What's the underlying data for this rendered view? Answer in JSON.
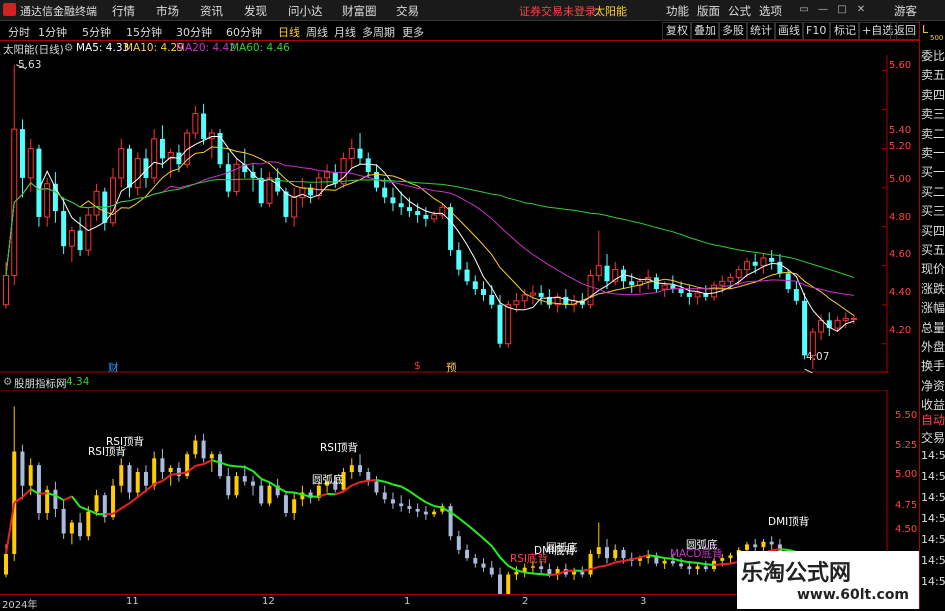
{
  "menubar": {
    "app_title": "通达信金融终端",
    "items": [
      "行情",
      "市场",
      "资讯",
      "发现",
      "问小达",
      "财富圈",
      "交易"
    ],
    "login_status": "证券交易未登录",
    "stock_name": "太阳能",
    "right_items": [
      "功能",
      "版面",
      "公式",
      "选项"
    ],
    "user": "游客"
  },
  "toolbar": {
    "periods": [
      "分时",
      "1分钟",
      "5分钟",
      "15分钟",
      "30分钟",
      "60分钟",
      "日线",
      "周线",
      "月线",
      "多周期",
      "更多"
    ],
    "active_period": "日线",
    "right_buttons": [
      "复权",
      "叠加",
      "多股",
      "统计",
      "画线",
      "F10",
      "标记",
      "+自选",
      "返回"
    ]
  },
  "main_chart": {
    "title": "太阳能(日线)",
    "ma": [
      {
        "label": "MA5: 4.33",
        "color": "#ffffff"
      },
      {
        "label": "MA10: 4.29",
        "color": "#ffcc33"
      },
      {
        "label": "MA20: 4.42",
        "color": "#cc33cc"
      },
      {
        "label": "MA60: 4.46",
        "color": "#33cc33"
      }
    ],
    "high_label": "5.63",
    "low_label": "4.07",
    "markers": [
      {
        "text": "财",
        "color": "#3399ff"
      },
      {
        "text": "$",
        "color": "#ff3333"
      },
      {
        "text": "预",
        "color": "#ffcc33"
      }
    ],
    "y_ticks": [
      "5.60",
      "5.40",
      "5.20",
      "5.00",
      "4.80",
      "4.60",
      "4.40",
      "4.20"
    ]
  },
  "indicator": {
    "title": "股朋指标网",
    "value": "4.34",
    "y_ticks": [
      "5.50",
      "5.25",
      "5.00",
      "4.75",
      "4.50"
    ],
    "annotations": [
      {
        "text": "RSI顶背",
        "color": "#ffffff"
      },
      {
        "text": "RSI顶背",
        "color": "#ffffff"
      },
      {
        "text": "RSI顶背",
        "color": "#ffffff"
      },
      {
        "text": "圆弧底",
        "color": "#ffffff"
      },
      {
        "text": "DMI底背",
        "color": "#ffffff"
      },
      {
        "text": "圆弧底",
        "color": "#ffffff"
      },
      {
        "text": "RSI底背",
        "color": "#ff4444"
      },
      {
        "text": "圆弧底",
        "color": "#ffffff"
      },
      {
        "text": "MACD底背",
        "color": "#cc33cc"
      },
      {
        "text": "DMI顶背",
        "color": "#ffffff"
      }
    ]
  },
  "dates": [
    "2024年",
    "11",
    "12",
    "1",
    "2",
    "3"
  ],
  "right_panel": {
    "header_l": "L",
    "header_num": "500",
    "items": [
      "委比",
      "卖五",
      "卖四",
      "卖三",
      "卖二",
      "卖一",
      "买一",
      "买二",
      "买三",
      "买四",
      "买五",
      "现价",
      "涨跌",
      "涨幅",
      "总量",
      "外盘",
      "换手",
      "净资",
      "收益"
    ],
    "auto_label": "自动",
    "trade_label": "交易",
    "times": [
      "14:56",
      "14:56",
      "14:56",
      "14:56",
      "14:56",
      "14:56",
      "14:56"
    ]
  },
  "watermark": {
    "title": "乐淘公式网",
    "url": "www.60lt.com"
  },
  "chart_data": {
    "type": "candlestick",
    "price_axis": {
      "min": 4.07,
      "max": 5.63,
      "ticks": [
        5.6,
        5.4,
        5.2,
        5.0,
        4.8,
        4.6,
        4.4,
        4.2
      ]
    },
    "candles": [
      [
        4.4,
        4.62,
        4.38,
        4.55
      ],
      [
        4.55,
        5.63,
        4.5,
        5.3
      ],
      [
        5.3,
        5.35,
        4.95,
        5.05
      ],
      [
        5.05,
        5.25,
        4.98,
        5.2
      ],
      [
        5.2,
        5.22,
        4.8,
        4.85
      ],
      [
        4.85,
        5.05,
        4.8,
        5.02
      ],
      [
        5.02,
        5.08,
        4.82,
        4.88
      ],
      [
        4.88,
        4.95,
        4.66,
        4.7
      ],
      [
        4.7,
        4.8,
        4.62,
        4.78
      ],
      [
        4.78,
        4.85,
        4.65,
        4.68
      ],
      [
        4.68,
        4.9,
        4.65,
        4.86
      ],
      [
        4.86,
        5.02,
        4.83,
        4.98
      ],
      [
        4.98,
        5.0,
        4.78,
        4.82
      ],
      [
        4.82,
        5.1,
        4.8,
        5.05
      ],
      [
        5.05,
        5.25,
        5.0,
        5.2
      ],
      [
        5.2,
        5.22,
        4.95,
        5.0
      ],
      [
        5.0,
        5.18,
        4.96,
        5.15
      ],
      [
        5.15,
        5.2,
        5.0,
        5.05
      ],
      [
        5.05,
        5.3,
        5.02,
        5.25
      ],
      [
        5.25,
        5.32,
        5.1,
        5.15
      ],
      [
        5.15,
        5.2,
        5.05,
        5.18
      ],
      [
        5.18,
        5.22,
        5.08,
        5.12
      ],
      [
        5.12,
        5.3,
        5.1,
        5.28
      ],
      [
        5.28,
        5.42,
        5.25,
        5.38
      ],
      [
        5.38,
        5.43,
        5.22,
        5.25
      ],
      [
        5.25,
        5.3,
        5.15,
        5.28
      ],
      [
        5.28,
        5.3,
        5.1,
        5.12
      ],
      [
        5.12,
        5.18,
        4.95,
        4.98
      ],
      [
        4.98,
        5.15,
        4.96,
        5.12
      ],
      [
        5.12,
        5.2,
        5.05,
        5.08
      ],
      [
        5.08,
        5.12,
        4.98,
        5.05
      ],
      [
        5.05,
        5.1,
        4.9,
        4.92
      ],
      [
        4.92,
        5.08,
        4.9,
        5.05
      ],
      [
        5.05,
        5.1,
        4.96,
        4.98
      ],
      [
        4.98,
        5.0,
        4.82,
        4.85
      ],
      [
        4.85,
        5.0,
        4.8,
        4.95
      ],
      [
        4.95,
        5.05,
        4.9,
        5.0
      ],
      [
        5.0,
        5.02,
        4.92,
        4.96
      ],
      [
        4.96,
        5.08,
        4.94,
        5.05
      ],
      [
        5.05,
        5.12,
        5.0,
        5.08
      ],
      [
        5.08,
        5.12,
        5.0,
        5.02
      ],
      [
        5.02,
        5.18,
        5.0,
        5.15
      ],
      [
        5.15,
        5.25,
        5.1,
        5.2
      ],
      [
        5.2,
        5.28,
        5.12,
        5.15
      ],
      [
        5.15,
        5.18,
        5.05,
        5.08
      ],
      [
        5.08,
        5.12,
        4.98,
        5.0
      ],
      [
        5.0,
        5.05,
        4.92,
        4.95
      ],
      [
        4.95,
        5.0,
        4.88,
        4.92
      ],
      [
        4.92,
        4.98,
        4.86,
        4.9
      ],
      [
        4.9,
        4.95,
        4.85,
        4.88
      ],
      [
        4.88,
        4.92,
        4.82,
        4.86
      ],
      [
        4.86,
        4.9,
        4.8,
        4.84
      ],
      [
        4.84,
        4.88,
        4.82,
        4.86
      ],
      [
        4.86,
        4.92,
        4.84,
        4.9
      ],
      [
        4.9,
        4.92,
        4.65,
        4.68
      ],
      [
        4.68,
        4.72,
        4.55,
        4.58
      ],
      [
        4.58,
        4.62,
        4.5,
        4.52
      ],
      [
        4.52,
        4.55,
        4.45,
        4.48
      ],
      [
        4.48,
        4.52,
        4.42,
        4.45
      ],
      [
        4.45,
        4.5,
        4.38,
        4.4
      ],
      [
        4.4,
        4.45,
        4.18,
        4.2
      ],
      [
        4.2,
        4.42,
        4.18,
        4.4
      ],
      [
        4.4,
        4.46,
        4.36,
        4.42
      ],
      [
        4.42,
        4.48,
        4.38,
        4.45
      ],
      [
        4.45,
        4.5,
        4.4,
        4.46
      ],
      [
        4.46,
        4.5,
        4.4,
        4.44
      ],
      [
        4.44,
        4.48,
        4.38,
        4.4
      ],
      [
        4.4,
        4.46,
        4.36,
        4.44
      ],
      [
        4.44,
        4.48,
        4.38,
        4.4
      ],
      [
        4.4,
        4.45,
        4.36,
        4.42
      ],
      [
        4.42,
        4.46,
        4.38,
        4.4
      ],
      [
        4.4,
        4.58,
        4.38,
        4.55
      ],
      [
        4.55,
        4.78,
        4.52,
        4.6
      ],
      [
        4.6,
        4.66,
        4.48,
        4.52
      ],
      [
        4.52,
        4.62,
        4.5,
        4.58
      ],
      [
        4.58,
        4.6,
        4.48,
        4.52
      ],
      [
        4.52,
        4.56,
        4.46,
        4.5
      ],
      [
        4.5,
        4.54,
        4.46,
        4.52
      ],
      [
        4.52,
        4.58,
        4.48,
        4.54
      ],
      [
        4.54,
        4.56,
        4.46,
        4.48
      ],
      [
        4.48,
        4.52,
        4.44,
        4.5
      ],
      [
        4.5,
        4.55,
        4.46,
        4.48
      ],
      [
        4.48,
        4.52,
        4.44,
        4.46
      ],
      [
        4.46,
        4.5,
        4.4,
        4.44
      ],
      [
        4.44,
        4.48,
        4.4,
        4.46
      ],
      [
        4.46,
        4.5,
        4.42,
        4.44
      ],
      [
        4.44,
        4.52,
        4.42,
        4.5
      ],
      [
        4.5,
        4.55,
        4.46,
        4.52
      ],
      [
        4.52,
        4.56,
        4.48,
        4.54
      ],
      [
        4.54,
        4.6,
        4.5,
        4.58
      ],
      [
        4.58,
        4.64,
        4.54,
        4.62
      ],
      [
        4.62,
        4.66,
        4.56,
        4.6
      ],
      [
        4.6,
        4.66,
        4.56,
        4.64
      ],
      [
        4.64,
        4.68,
        4.58,
        4.62
      ],
      [
        4.62,
        4.66,
        4.54,
        4.56
      ],
      [
        4.56,
        4.58,
        4.46,
        4.48
      ],
      [
        4.48,
        4.52,
        4.4,
        4.42
      ],
      [
        4.42,
        4.46,
        4.12,
        4.14
      ],
      [
        4.14,
        4.28,
        4.07,
        4.26
      ],
      [
        4.26,
        4.35,
        4.22,
        4.32
      ],
      [
        4.32,
        4.36,
        4.24,
        4.28
      ],
      [
        4.28,
        4.34,
        4.26,
        4.32
      ],
      [
        4.32,
        4.36,
        4.28,
        4.33
      ],
      [
        4.33,
        4.35,
        4.3,
        4.33
      ]
    ]
  }
}
